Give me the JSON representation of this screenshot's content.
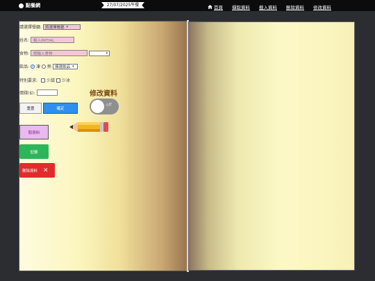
{
  "header": {
    "brand": "點餐網",
    "date": "27/07/2025午餐",
    "nav": [
      {
        "label": "首頁",
        "icon": "home-icon"
      },
      {
        "label": "擷取資料"
      },
      {
        "label": "載入資料"
      },
      {
        "label": "刪除資料"
      },
      {
        "label": "修改資料"
      }
    ]
  },
  "form": {
    "restaurant_label": "請選擇餐廳:",
    "restaurant_value": "請選擇餐廳",
    "name_label": "姓名:",
    "name_placeholder": "輸入INITIAL",
    "food_label": "食物:",
    "food_placeholder": "請輸入食物",
    "drink_label": "飲品:",
    "drink_opt1": "凍",
    "drink_opt2": "熱",
    "drink_select": "揀選飲品",
    "special_label": "特別要求:",
    "special_opt1": "少甜",
    "special_opt2": "少冰",
    "price_label": "價錢($):"
  },
  "buttons": {
    "reset": "重置",
    "confirm": "確定",
    "fetch": "取資料",
    "record": "記錄",
    "delete": "刪除資料"
  },
  "modify": {
    "title": "修改資料",
    "toggle_label": "off"
  },
  "colors": {
    "confirm": "#2d8ff0",
    "record": "#2db55a",
    "delete": "#e22b2b",
    "fetch": "#e9b9ef",
    "input_pink": "#f4c6d8"
  }
}
